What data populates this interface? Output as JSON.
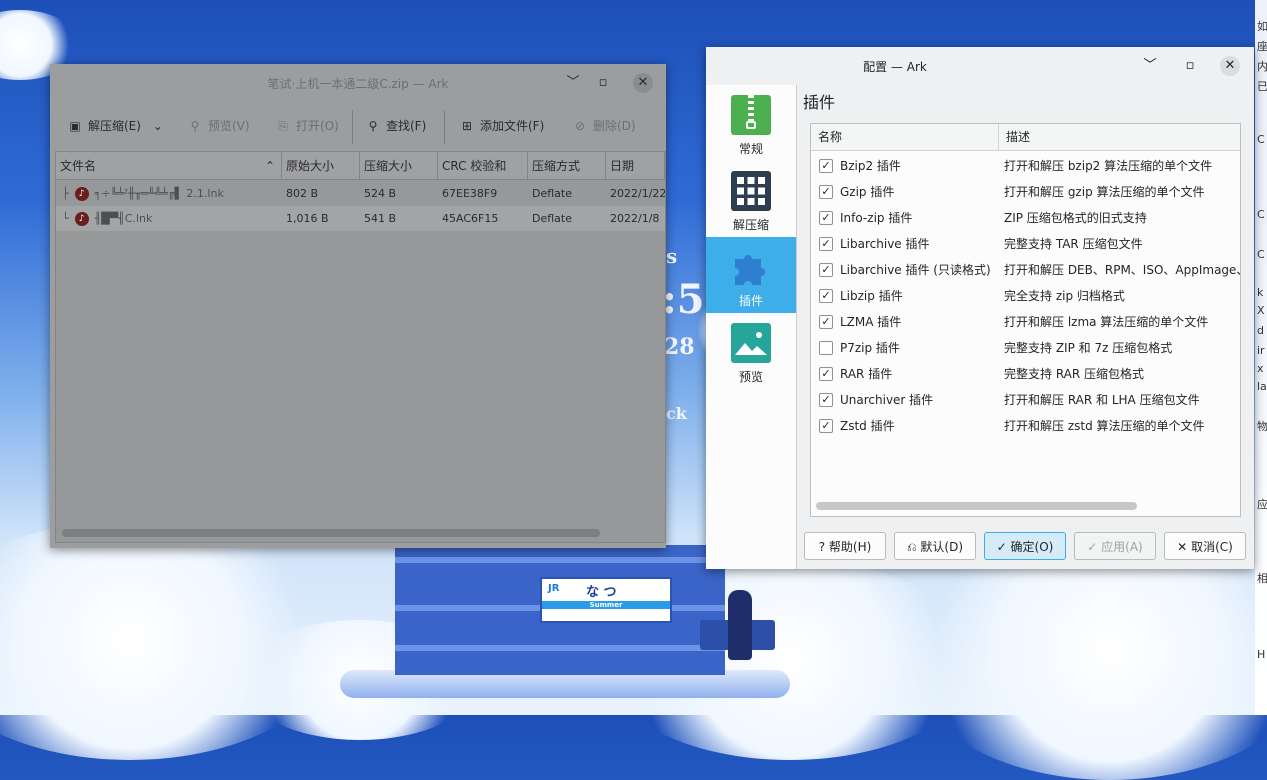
{
  "ark_window": {
    "title": "笔试·上机一本通二级C.zip — Ark",
    "toolbar": {
      "extract": "解压缩(E)",
      "preview": "预览(V)",
      "open": "打开(O)",
      "find": "查找(F)",
      "add_file": "添加文件(F)",
      "delete": "删除(D)"
    },
    "columns": [
      "文件名",
      "原始大小",
      "压缩大小",
      "CRC 校验和",
      "压缩方式",
      "日期"
    ],
    "rows": [
      {
        "name": "╕÷╚╧²╫╥═╨╩╧╔▌ 2.1.lnk",
        "size": "802 B",
        "compressed": "524 B",
        "crc": "67EE38F9",
        "method": "Deflate",
        "date": "2022/1/22"
      },
      {
        "name": "╢█▀╢C.lnk",
        "size": "1,016 B",
        "compressed": "541 B",
        "crc": "45AC6F15",
        "method": "Deflate",
        "date": "2022/1/8"
      }
    ]
  },
  "config_dialog": {
    "title": "配置 — Ark",
    "sidebar": [
      {
        "label": "常规",
        "icon": "zip-file-icon",
        "color": "#4caf50"
      },
      {
        "label": "解压缩",
        "icon": "grid-icon",
        "color": "#2c3e50"
      },
      {
        "label": "插件",
        "icon": "puzzle-icon",
        "color": "#2f7fd1"
      },
      {
        "label": "预览",
        "icon": "image-icon",
        "color": "#26a69a"
      }
    ],
    "page_title": "插件",
    "columns": {
      "name": "名称",
      "desc": "描述"
    },
    "plugins": [
      {
        "name": "Bzip2 插件",
        "desc": "打开和解压 bzip2 算法压缩的单个文件",
        "checked": "✓"
      },
      {
        "name": "Gzip 插件",
        "desc": "打开和解压 gzip 算法压缩的单个文件",
        "checked": "✓"
      },
      {
        "name": "Info-zip 插件",
        "desc": "ZIP 压缩包格式的旧式支持",
        "checked": "✓"
      },
      {
        "name": "Libarchive 插件",
        "desc": "完整支持 TAR 压缩包文件",
        "checked": "✓"
      },
      {
        "name": "Libarchive 插件 (只读格式)",
        "desc": "打开和解压 DEB、RPM、ISO、AppImage、XAR",
        "checked": "✓"
      },
      {
        "name": "Libzip 插件",
        "desc": "完全支持 zip 归档格式",
        "checked": "✓"
      },
      {
        "name": "LZMA 插件",
        "desc": "打开和解压 lzma 算法压缩的单个文件",
        "checked": "✓"
      },
      {
        "name": "P7zip 插件",
        "desc": "完整支持 ZIP 和 7z 压缩包格式",
        "checked": ""
      },
      {
        "name": "RAR 插件",
        "desc": "完整支持 RAR 压缩包格式",
        "checked": "✓"
      },
      {
        "name": "Unarchiver 插件",
        "desc": "打开和解压 RAR 和 LHA 压缩包文件",
        "checked": "✓"
      },
      {
        "name": "Zstd 插件",
        "desc": "打开和解压 zstd 算法压缩的单个文件",
        "checked": "✓"
      }
    ],
    "buttons": {
      "help": "帮助(H)",
      "defaults": "默认(D)",
      "ok": "确定(O)",
      "apply": "应用(A)",
      "cancel": "取消(C)"
    }
  },
  "desktop": {
    "station_sign": {
      "jr": "JR",
      "kana": "な つ",
      "romaji": "Summer"
    },
    "clock_fragments": [
      "s",
      ":5",
      "28",
      "ck"
    ],
    "widget_chars": [
      "如",
      "座",
      "内",
      "已",
      "C",
      "C",
      "C",
      "k",
      "X",
      "d",
      "ir",
      "x",
      "la",
      "物",
      "应",
      "相",
      "H"
    ]
  },
  "colors": {
    "accent": "#3daee9",
    "dim_window": "#9c9d9f"
  }
}
